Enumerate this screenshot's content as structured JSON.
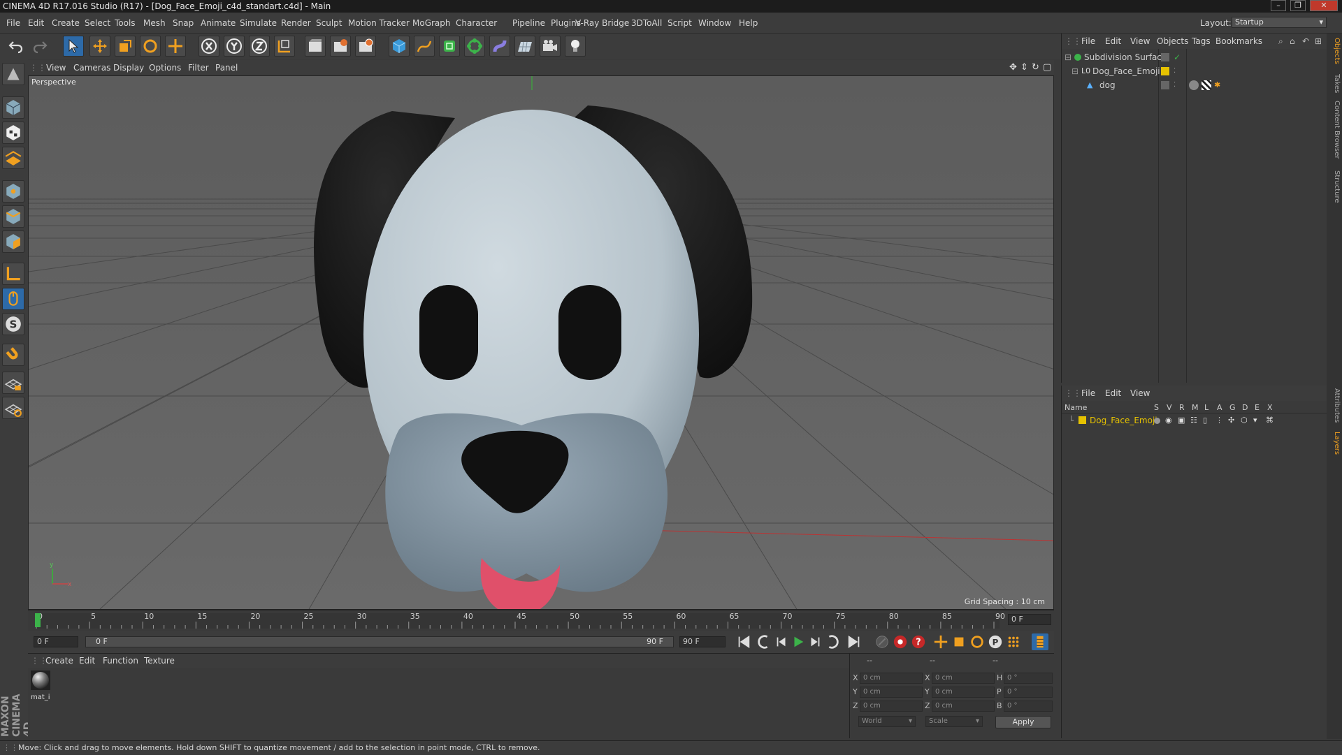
{
  "window": {
    "title": "CINEMA 4D R17.016 Studio (R17) - [Dog_Face_Emoji_c4d_standart.c4d] - Main",
    "controls": [
      "–",
      "❐",
      "✕"
    ]
  },
  "menubar": {
    "items": [
      "File",
      "Edit",
      "Create",
      "Select",
      "Tools",
      "Mesh",
      "Snap",
      "Animate",
      "Simulate",
      "Render",
      "Sculpt",
      "Motion Tracker",
      "MoGraph",
      "Character",
      "Pipeline",
      "Plugins",
      "V-Ray Bridge",
      "3DToAll",
      "Script",
      "Window",
      "Help"
    ],
    "layout_label": "Layout:",
    "layout_value": "Startup"
  },
  "toolbar": {
    "icons": [
      "undo-icon",
      "redo-icon",
      "select-arrow-icon",
      "move-icon",
      "scale-icon",
      "rotate-icon",
      "live-select-icon",
      "x-axis-icon",
      "y-axis-icon",
      "z-axis-icon",
      "world-coord-icon",
      "render-view-icon",
      "render-picture-viewer-icon",
      "render-settings-icon",
      "cube-icon",
      "pen-spline-icon",
      "subdivision-icon",
      "array-icon",
      "deformer-icon",
      "floor-icon",
      "camera-icon",
      "light-icon"
    ]
  },
  "viewport": {
    "menu": [
      "View",
      "Cameras",
      "Display",
      "Options",
      "Filter",
      "Panel"
    ],
    "label": "Perspective",
    "grid_spacing": "Grid Spacing : 10 cm",
    "colors": {
      "bg": "#626262",
      "face": "#bcc8d0",
      "ears": "#1a1a1a",
      "muzzle": "#8496a4",
      "tongue": "#e0506a"
    }
  },
  "timeline": {
    "ticks": [
      "0",
      "5",
      "10",
      "15",
      "20",
      "25",
      "30",
      "35",
      "40",
      "45",
      "50",
      "55",
      "60",
      "65",
      "70",
      "75",
      "80",
      "85",
      "90"
    ],
    "current_frame": "0 F",
    "start_field": "0 F",
    "range_start": "0 F",
    "range_end": "90 F",
    "end_field": "90 F"
  },
  "material_manager": {
    "menu": [
      "Create",
      "Edit",
      "Function",
      "Texture"
    ],
    "materials": [
      {
        "name": "mat_i"
      }
    ]
  },
  "coordinates": {
    "header": [
      "--",
      "--",
      "--"
    ],
    "rows": [
      {
        "a": "X",
        "v1": "0 cm",
        "b": "X",
        "v2": "0 cm",
        "c": "H",
        "v3": "0 °"
      },
      {
        "a": "Y",
        "v1": "0 cm",
        "b": "Y",
        "v2": "0 cm",
        "c": "P",
        "v3": "0 °"
      },
      {
        "a": "Z",
        "v1": "0 cm",
        "b": "Z",
        "v2": "0 cm",
        "c": "B",
        "v3": "0 °"
      }
    ],
    "world": "World",
    "scale": "Scale",
    "apply": "Apply"
  },
  "object_manager": {
    "menu": [
      "File",
      "Edit",
      "View",
      "Objects",
      "Tags",
      "Bookmarks"
    ],
    "objects": [
      {
        "name": "Subdivision Surface",
        "color": "#d6d6d6"
      },
      {
        "name": "Dog_Face_Emoji",
        "color": "#d6d6d6"
      },
      {
        "name": "dog",
        "color": "#d6d6d6"
      }
    ]
  },
  "layer_manager": {
    "menu": [
      "File",
      "Edit",
      "View"
    ],
    "columns": [
      "Name",
      "S",
      "V",
      "R",
      "M",
      "L",
      "A",
      "G",
      "D",
      "E",
      "X"
    ],
    "layers": [
      {
        "name": "Dog_Face_Emoji",
        "color": "#e6c200"
      }
    ]
  },
  "side_tabs": [
    "Objects",
    "Takes",
    "Content Browser",
    "Structure",
    "Attributes",
    "Layers"
  ],
  "status": "Move: Click and drag to move elements. Hold down SHIFT to quantize movement / add to the selection in point mode, CTRL to remove."
}
